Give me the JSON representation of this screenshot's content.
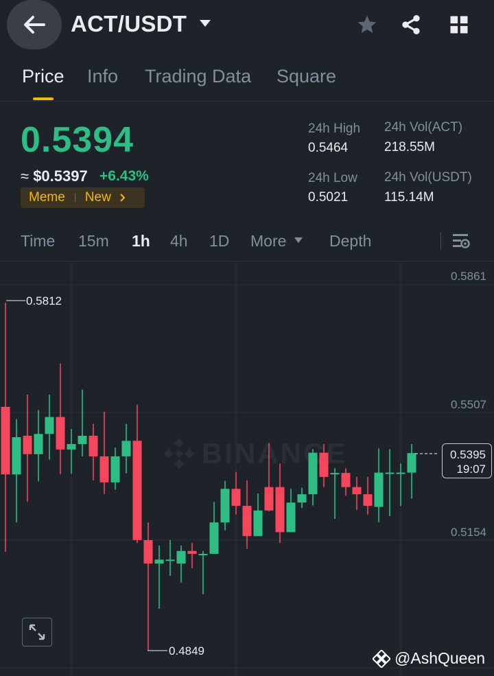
{
  "header": {
    "pair": "ACT/USDT",
    "icons": [
      "back-arrow-icon",
      "caret-down-icon",
      "star-icon",
      "share-icon",
      "grid-icon"
    ]
  },
  "tabs": [
    {
      "label": "Price",
      "active": true
    },
    {
      "label": "Info",
      "active": false
    },
    {
      "label": "Trading Data",
      "active": false
    },
    {
      "label": "Square",
      "active": false
    }
  ],
  "price": {
    "last": "0.5394",
    "fiat_prefix": "≈ ",
    "fiat": "$0.5397",
    "change": "+6.43%",
    "tags": [
      "Meme",
      "New"
    ],
    "up_color": "#2ebd85",
    "down_color": "#f6465d"
  },
  "stats": {
    "high_label": "24h High",
    "high_value": "0.5464",
    "low_label": "24h Low",
    "low_value": "0.5021",
    "vol_base_label": "24h Vol(ACT)",
    "vol_base_value": "218.55M",
    "vol_quote_label": "24h Vol(USDT)",
    "vol_quote_value": "115.14M"
  },
  "intervals": [
    {
      "label": "Time",
      "active": false
    },
    {
      "label": "15m",
      "active": false
    },
    {
      "label": "1h",
      "active": true
    },
    {
      "label": "4h",
      "active": false
    },
    {
      "label": "1D",
      "active": false
    },
    {
      "label": "More",
      "active": false
    },
    {
      "label": "Depth",
      "active": false
    }
  ],
  "chart": {
    "y_ticks": [
      "0.5861",
      "0.5507",
      "0.5154"
    ],
    "max_marker": "0.5812",
    "min_marker": "0.4849",
    "current_price": "0.5395",
    "countdown": "19:07",
    "watermark": "BINANCE"
  },
  "chart_data": {
    "type": "candlestick",
    "ylim": [
      0.479,
      0.593
    ],
    "y_ticks": [
      0.5861,
      0.5507,
      0.5154
    ],
    "candles": [
      {
        "o": 0.5523,
        "h": 0.5812,
        "l": 0.5122,
        "c": 0.5336
      },
      {
        "o": 0.5336,
        "h": 0.5489,
        "l": 0.5203,
        "c": 0.5439
      },
      {
        "o": 0.5443,
        "h": 0.5557,
        "l": 0.526,
        "c": 0.5392
      },
      {
        "o": 0.5392,
        "h": 0.5514,
        "l": 0.5317,
        "c": 0.5448
      },
      {
        "o": 0.5448,
        "h": 0.5557,
        "l": 0.5377,
        "c": 0.5495
      },
      {
        "o": 0.5495,
        "h": 0.5643,
        "l": 0.5336,
        "c": 0.5405
      },
      {
        "o": 0.5405,
        "h": 0.5462,
        "l": 0.5338,
        "c": 0.542
      },
      {
        "o": 0.542,
        "h": 0.5571,
        "l": 0.5386,
        "c": 0.5443
      },
      {
        "o": 0.5443,
        "h": 0.5476,
        "l": 0.532,
        "c": 0.5386
      },
      {
        "o": 0.5386,
        "h": 0.551,
        "l": 0.5282,
        "c": 0.5314
      },
      {
        "o": 0.5314,
        "h": 0.541,
        "l": 0.5294,
        "c": 0.5386
      },
      {
        "o": 0.5386,
        "h": 0.5476,
        "l": 0.5339,
        "c": 0.5429
      },
      {
        "o": 0.5429,
        "h": 0.5529,
        "l": 0.5146,
        "c": 0.5154
      },
      {
        "o": 0.5154,
        "h": 0.5203,
        "l": 0.4849,
        "c": 0.5089
      },
      {
        "o": 0.5089,
        "h": 0.5139,
        "l": 0.4964,
        "c": 0.51
      },
      {
        "o": 0.51,
        "h": 0.5154,
        "l": 0.5055,
        "c": 0.51
      },
      {
        "o": 0.5089,
        "h": 0.5139,
        "l": 0.5037,
        "c": 0.5124
      },
      {
        "o": 0.5124,
        "h": 0.5146,
        "l": 0.5076,
        "c": 0.5116
      },
      {
        "o": 0.5116,
        "h": 0.5124,
        "l": 0.5004,
        "c": 0.5116
      },
      {
        "o": 0.5116,
        "h": 0.526,
        "l": 0.5116,
        "c": 0.5203
      },
      {
        "o": 0.5203,
        "h": 0.5318,
        "l": 0.5181,
        "c": 0.5296
      },
      {
        "o": 0.5296,
        "h": 0.5343,
        "l": 0.5225,
        "c": 0.5249
      },
      {
        "o": 0.5249,
        "h": 0.532,
        "l": 0.513,
        "c": 0.5165
      },
      {
        "o": 0.5165,
        "h": 0.5283,
        "l": 0.5165,
        "c": 0.5236
      },
      {
        "o": 0.5301,
        "h": 0.5423,
        "l": 0.5234,
        "c": 0.5236
      },
      {
        "o": 0.5301,
        "h": 0.5366,
        "l": 0.5146,
        "c": 0.5176
      },
      {
        "o": 0.5176,
        "h": 0.5296,
        "l": 0.5176,
        "c": 0.5258
      },
      {
        "o": 0.5258,
        "h": 0.5299,
        "l": 0.5243,
        "c": 0.5281
      },
      {
        "o": 0.5281,
        "h": 0.5406,
        "l": 0.525,
        "c": 0.5396
      },
      {
        "o": 0.5396,
        "h": 0.542,
        "l": 0.5301,
        "c": 0.5329
      },
      {
        "o": 0.534,
        "h": 0.5353,
        "l": 0.5213,
        "c": 0.534
      },
      {
        "o": 0.534,
        "h": 0.5353,
        "l": 0.5277,
        "c": 0.5301
      },
      {
        "o": 0.5301,
        "h": 0.5329,
        "l": 0.5237,
        "c": 0.5281
      },
      {
        "o": 0.5281,
        "h": 0.5329,
        "l": 0.5225,
        "c": 0.5249
      },
      {
        "o": 0.5246,
        "h": 0.5408,
        "l": 0.5204,
        "c": 0.5341
      },
      {
        "o": 0.5341,
        "h": 0.5406,
        "l": 0.522,
        "c": 0.5341
      },
      {
        "o": 0.5341,
        "h": 0.5366,
        "l": 0.5248,
        "c": 0.5341
      },
      {
        "o": 0.5341,
        "h": 0.542,
        "l": 0.5269,
        "c": 0.5395
      }
    ]
  },
  "credit": "@AshQueen"
}
